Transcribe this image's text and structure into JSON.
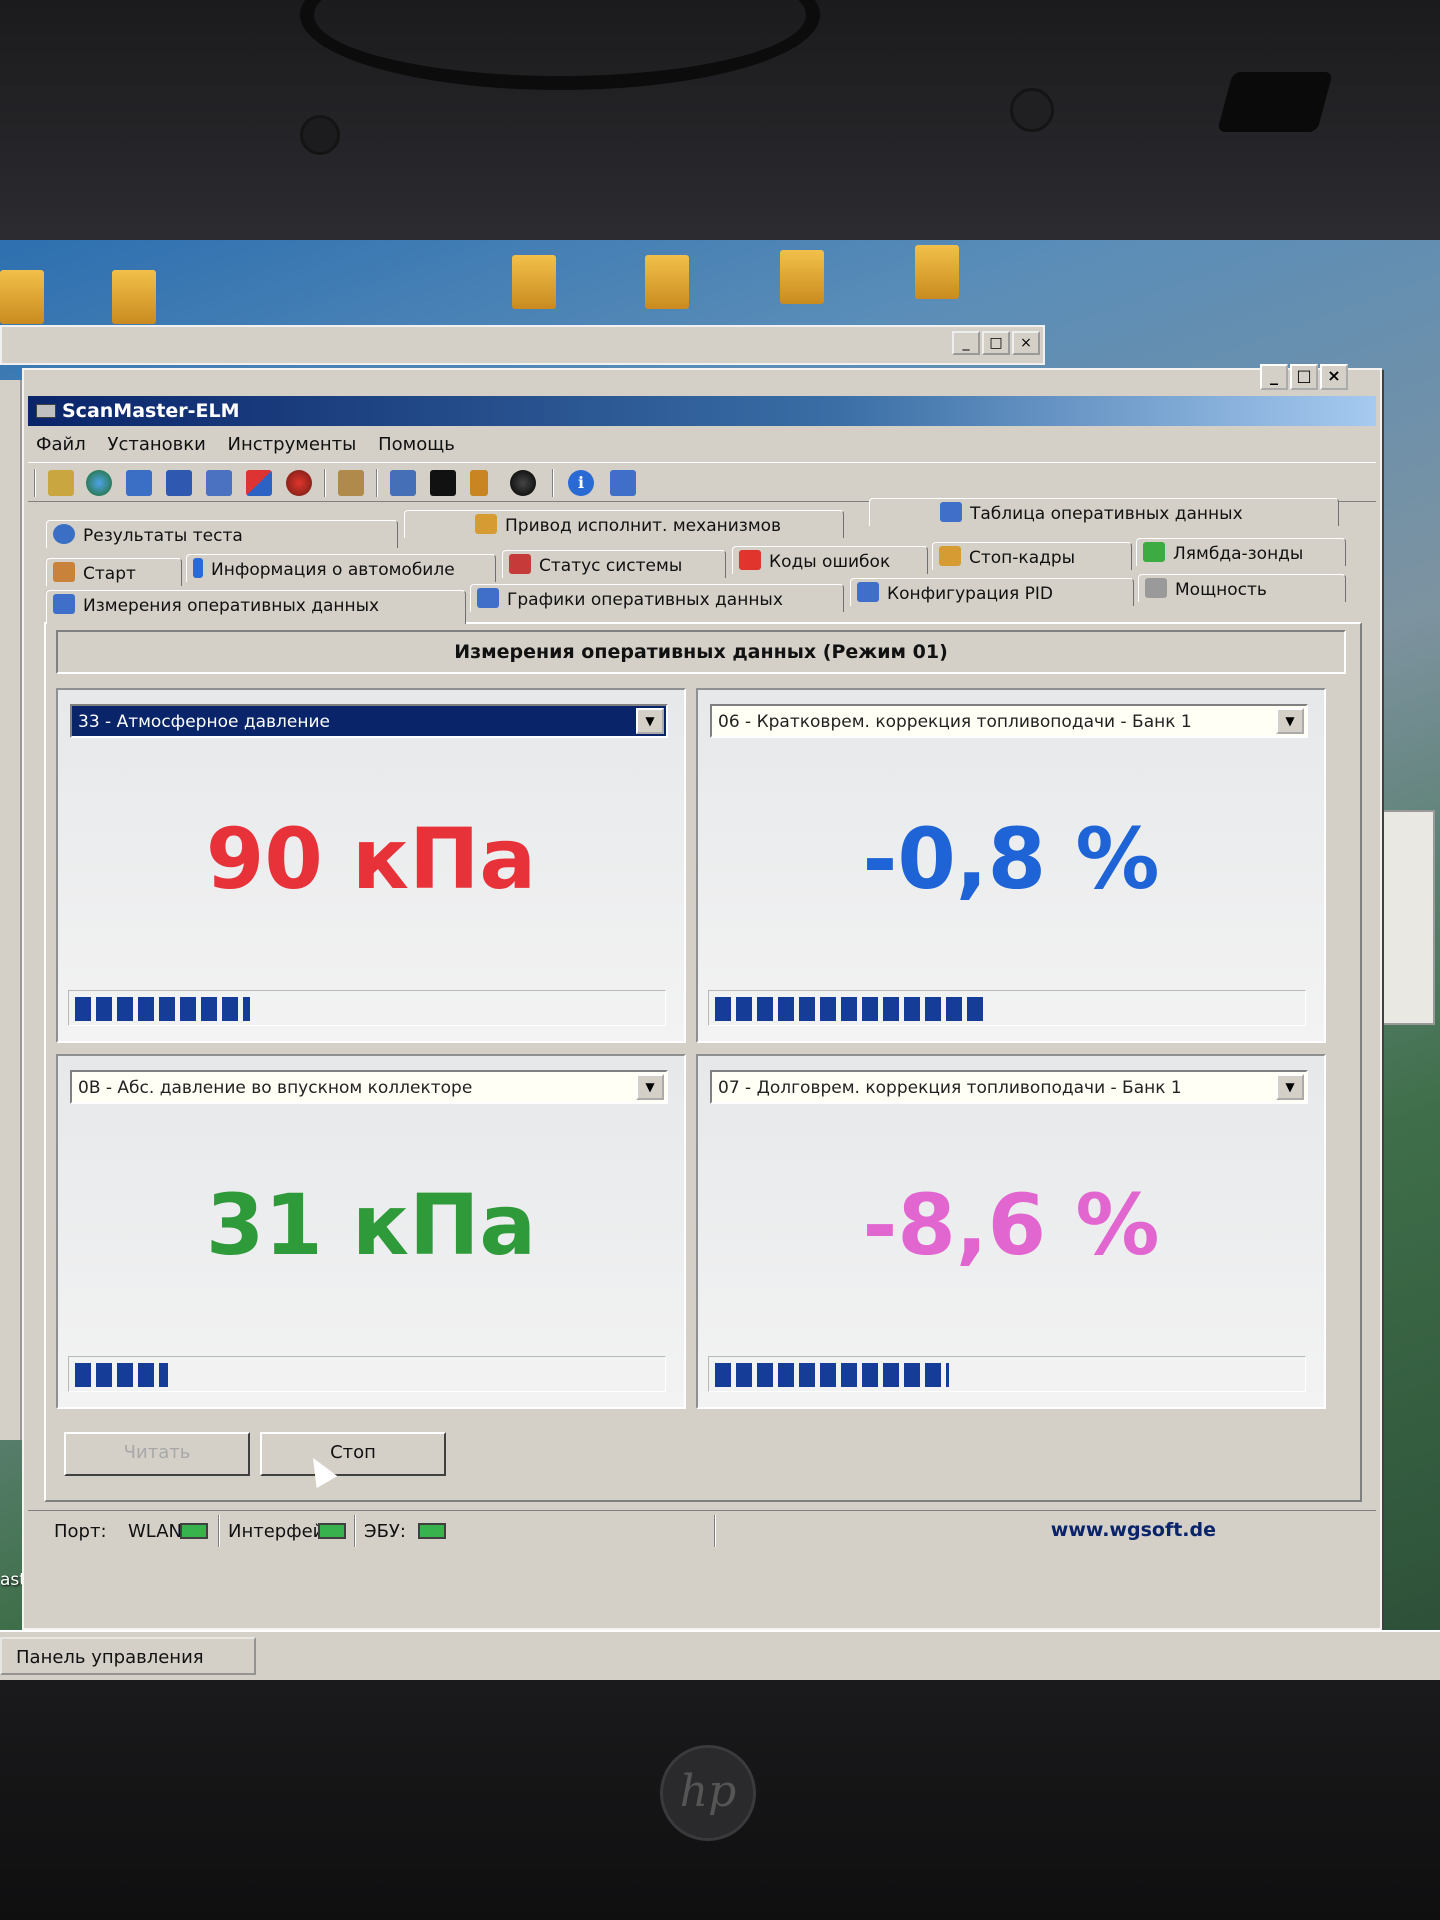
{
  "window": {
    "title": "ScanMaster-ELM"
  },
  "menu": [
    "Файл",
    "Установки",
    "Инструменты",
    "Помощь"
  ],
  "tabs": {
    "row1": [
      "Результаты теста",
      "Привод исполнит. механизмов",
      "Таблица оперативных данных"
    ],
    "row2": [
      "Старт",
      "Информация о автомобиле",
      "Статус системы",
      "Коды ошибок",
      "Стоп-кадры",
      "Лямбда-зонды"
    ],
    "row3": [
      "Измерения оперативных данных",
      "Графики оперативных данных",
      "Конфигурация PID",
      "Мощность"
    ]
  },
  "panel": {
    "header": "Измерения оперативных данных (Режим 01)"
  },
  "gauges": [
    {
      "pid": "33 - Атмосферное давление",
      "value": "90 кПа",
      "color": "#e8323a",
      "bar_fraction": 0.3,
      "selected": true
    },
    {
      "pid": "06 - Кратковрем. коррекция топливоподачи - Банк 1",
      "value": "-0,8 %",
      "color": "#1e64d6",
      "bar_fraction": 0.46,
      "selected": false
    },
    {
      "pid": "0B - Абс. давление во впускном коллекторе",
      "value": "31 кПа",
      "color": "#2f9a3a",
      "bar_fraction": 0.16,
      "selected": false
    },
    {
      "pid": "07 - Долговрем. коррекция топливоподачи - Банк 1",
      "value": "-8,6 %",
      "color": "#e266cf",
      "bar_fraction": 0.4,
      "selected": false
    }
  ],
  "buttons": {
    "read": "Читать",
    "stop": "Стоп"
  },
  "status": {
    "port_label": "Порт:",
    "port_value": "WLAN",
    "interface_label": "Интерфейс:",
    "ecu_label": "ЭБУ:",
    "url": "www.wgsoft.de"
  },
  "taskbar": {
    "item": "Панель управления"
  },
  "desktop": {
    "file_label": "ast_free_..."
  }
}
